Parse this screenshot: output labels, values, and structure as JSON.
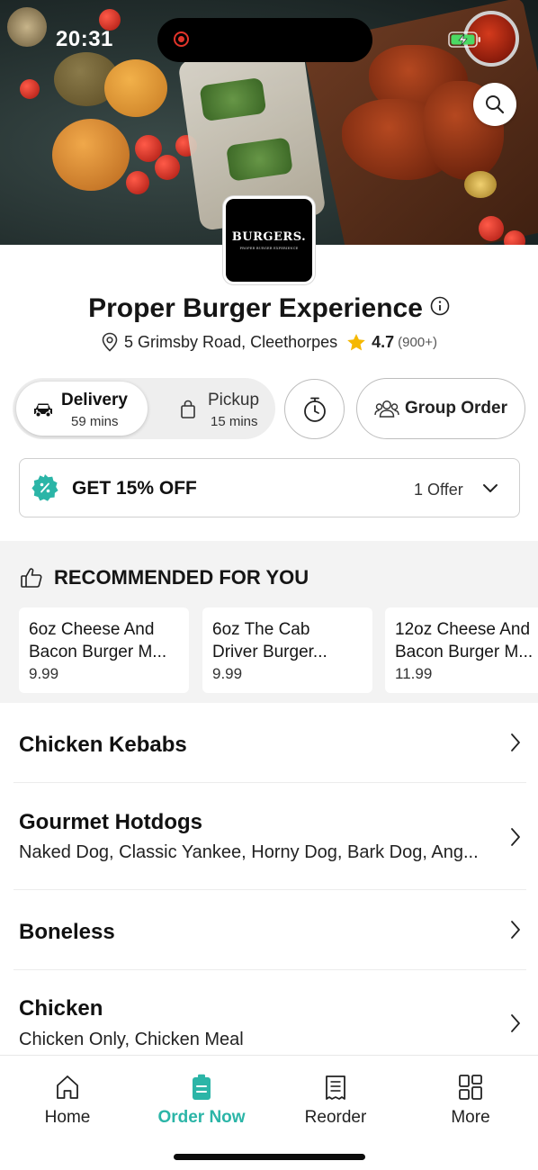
{
  "status_bar": {
    "time": "20:31"
  },
  "restaurant": {
    "logo_text": "BURGERS.",
    "logo_subtext": "PROPER BURGER EXPERIENCE",
    "name": "Proper Burger Experience",
    "address": "5 Grimsby Road, Cleethorpes",
    "rating": "4.7",
    "rating_count": "(900+)"
  },
  "order_mode": {
    "selected": "Delivery",
    "options": [
      {
        "label": "Delivery",
        "time": "59 mins"
      },
      {
        "label": "Pickup",
        "time": "15 mins"
      }
    ],
    "group_order_label": "Group Order"
  },
  "offer": {
    "title": "GET 15% OFF",
    "count": "1 Offer"
  },
  "recommended": {
    "heading": "RECOMMENDED FOR YOU",
    "items": [
      {
        "name_line1": "6oz Cheese And",
        "name_line2": "Bacon Burger M...",
        "price": "9.99"
      },
      {
        "name_line1": "6oz The Cab",
        "name_line2": "Driver Burger...",
        "price": "9.99"
      },
      {
        "name_line1": "12oz Cheese And",
        "name_line2": "Bacon Burger M...",
        "price": "11.99"
      }
    ]
  },
  "categories": [
    {
      "title": "Chicken Kebabs",
      "subtitle": ""
    },
    {
      "title": "Gourmet Hotdogs",
      "subtitle": "Naked Dog, Classic Yankee, Horny Dog, Bark Dog, Ang..."
    },
    {
      "title": "Boneless",
      "subtitle": ""
    },
    {
      "title": "Chicken",
      "subtitle": "Chicken Only, Chicken Meal"
    }
  ],
  "bottom_nav": {
    "active": "Order Now",
    "items": [
      {
        "label": "Home",
        "icon": "home-icon"
      },
      {
        "label": "Order Now",
        "icon": "order-bag-icon"
      },
      {
        "label": "Reorder",
        "icon": "receipt-icon"
      },
      {
        "label": "More",
        "icon": "grid-icon"
      }
    ]
  },
  "colors": {
    "accent": "#2bb5a7",
    "rating_star": "#f5b800"
  }
}
